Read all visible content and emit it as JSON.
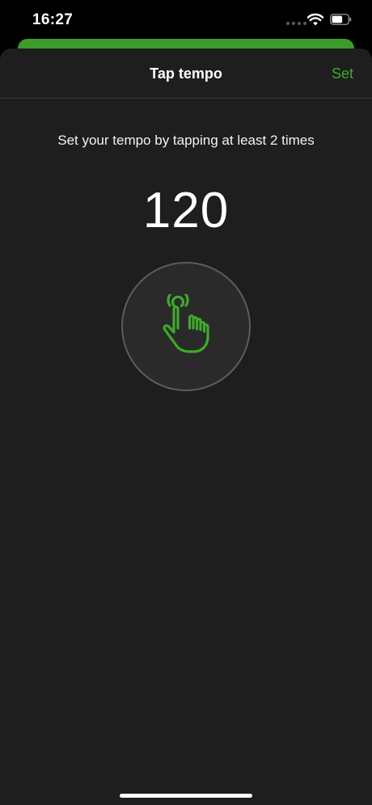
{
  "status_bar": {
    "time": "16:27",
    "icons": [
      "signal-dots-icon",
      "wifi-icon",
      "battery-icon"
    ]
  },
  "nav": {
    "title": "Tap tempo",
    "action_label": "Set"
  },
  "content": {
    "instruction": "Set your tempo by tapping at least 2 times",
    "tempo": "120",
    "tap_icon": "tap-hand-icon"
  },
  "colors": {
    "accent": "#3daa2a",
    "sheet_background": "#1e1e1e",
    "background_sheet": "#3d9a2c"
  }
}
